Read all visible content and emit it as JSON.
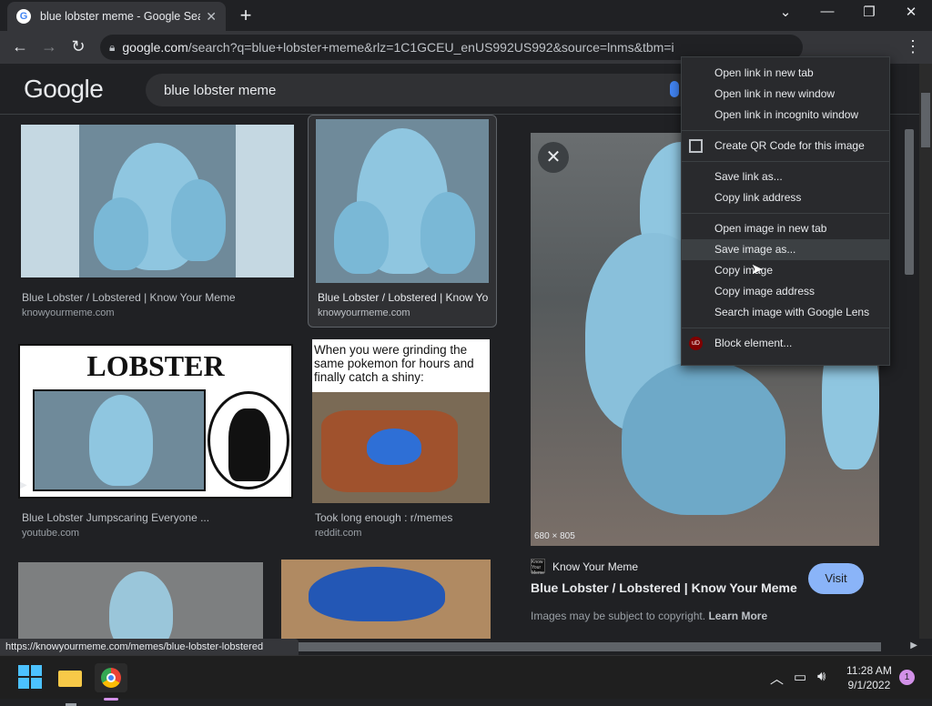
{
  "browser": {
    "tab_title": "blue lobster meme - Google Search",
    "tab_favicon": "G",
    "url_host": "google.com",
    "url_path": "/search?q=blue+lobster+meme&rlz=1C1GCEU_enUS992US992&source=lnms&tbm=i",
    "status_link": "https://knowyourmeme.com/memes/blue-lobster-lobstered"
  },
  "google": {
    "logo": "Google",
    "query": "blue lobster meme"
  },
  "results": [
    {
      "caption": "Blue Lobster / Lobstered | Know Your Meme",
      "source": "knowyourmeme.com"
    },
    {
      "caption": "Blue Lobster / Lobstered | Know Your Meme",
      "source": "knowyourmeme.com"
    },
    {
      "caption": "Blue Lobster Jumpscaring Everyone ...",
      "source": "youtube.com"
    },
    {
      "caption": "Took long enough : r/memes",
      "source": "reddit.com"
    }
  ],
  "meme": {
    "lobster_text": "LOBSTER",
    "reddit_text": "When you were grinding the same pokemon for hours and finally catch a shiny:"
  },
  "preview": {
    "dims": "680 × 805",
    "site": "Know Your Meme",
    "site_icon_text": "Know Your Meme",
    "title": "Blue Lobster / Lobstered | Know Your Meme",
    "visit": "Visit",
    "copyright": "Images may be subject to copyright.",
    "learn_more": "Learn More"
  },
  "context_menu": {
    "items": [
      "Open link in new tab",
      "Open link in new window",
      "Open link in incognito window",
      "Create QR Code for this image",
      "Save link as...",
      "Copy link address",
      "Open image in new tab",
      "Save image as...",
      "Copy image",
      "Copy image address",
      "Search image with Google Lens",
      "Block element..."
    ],
    "highlighted": "Save image as..."
  },
  "taskbar": {
    "time": "11:28 AM",
    "date": "9/1/2022",
    "notifications": "1"
  },
  "colors": {
    "accent": "#8ab4f8",
    "background": "#202124",
    "lobster_blue": "#8fc6e0"
  }
}
